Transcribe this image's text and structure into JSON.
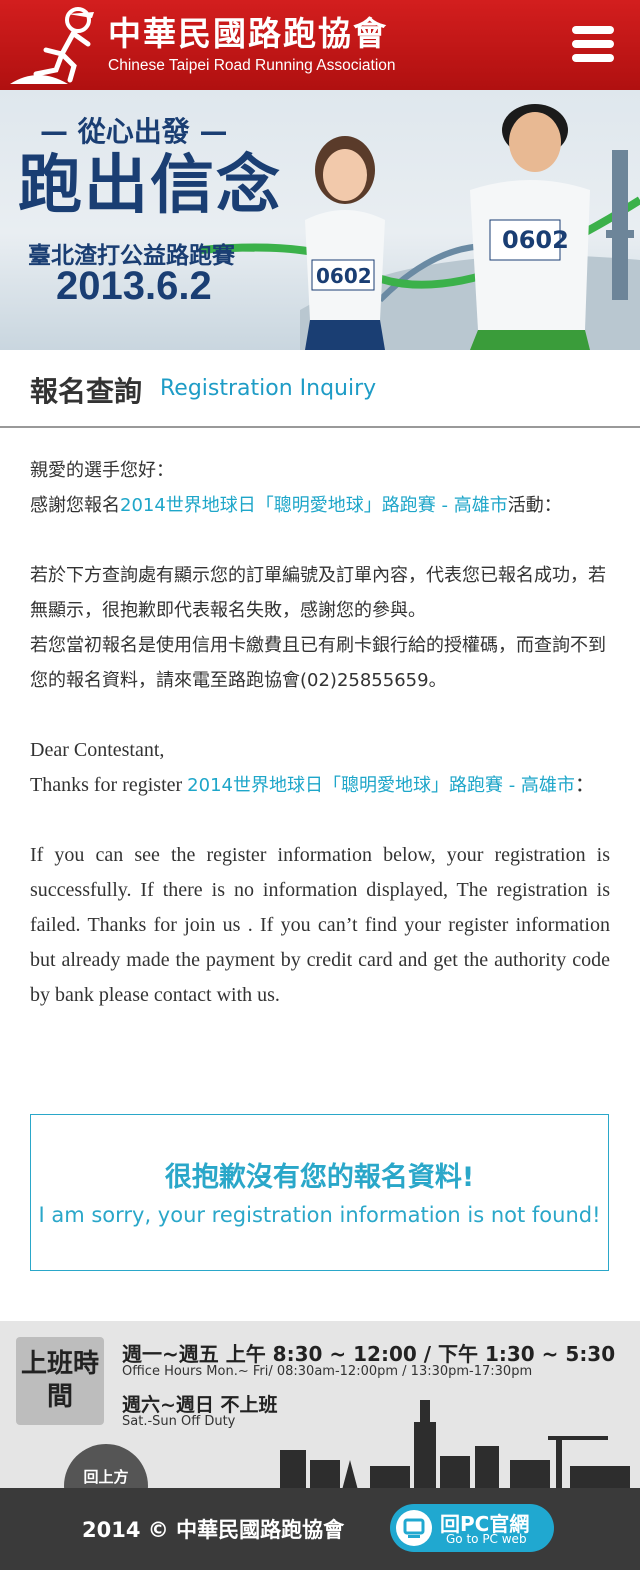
{
  "header": {
    "title": "中華民國路跑協會",
    "subtitle": "Chinese Taipei Road Running Association"
  },
  "banner": {
    "tagline": "— 從心出發 —",
    "headline": "跑出信念",
    "event": "臺北渣打公益路跑賽",
    "date": "2013.6.2",
    "bib_left": "0602",
    "bib_right": "0602"
  },
  "page": {
    "title_zh": "報名查詢",
    "title_en": "Registration Inquiry"
  },
  "content": {
    "greeting_zh": "親愛的選手您好：",
    "thanks_zh_pre": "感謝您報名",
    "event_name": "2014世界地球日「聰明愛地球」路跑賽 - 高雄市",
    "thanks_zh_post": "活動：",
    "para1_zh": "若於下方查詢處有顯示您的訂單編號及訂單內容，代表您已報名成功，若無顯示，很抱歉即代表報名失敗，感謝您的參與。",
    "para2_zh": "若您當初報名是使用信用卡繳費且已有刷卡銀行給的授權碼，而查詢不到您的報名資料，請來電至路跑協會(02)25855659。",
    "greeting_en": "Dear Contestant,",
    "thanks_en_pre": "Thanks for register ",
    "thanks_en_post": "：",
    "para_en": "If you can see the register information below, your registration is successfully. If there is no information displayed, The registration is failed. Thanks for join us . If you can’t find your register information but already made the payment by credit card and get the authority code by bank please contact with us."
  },
  "notice": {
    "zh": "很抱歉沒有您的報名資料!",
    "en": "I am sorry, your registration information is not found!"
  },
  "office": {
    "badge": "上班時間",
    "weekday_zh": "週一~週五 上午 8:30 ~ 12:00 / 下午 1:30 ~ 5:30",
    "weekday_en": "Office Hours  Mon.~ Fri/ 08:30am-12:00pm / 13:30pm-17:30pm",
    "weekend_zh": "週六~週日 不上班",
    "weekend_en": "Sat.-Sun Off Duty"
  },
  "footer": {
    "back_to_top": "回上方",
    "copyright": "2014 © 中華民國路跑協會",
    "pc_zh": "回PC官網",
    "pc_en": "Go to PC web"
  },
  "colors": {
    "header_red": "#c8161b",
    "accent_cyan": "#1ea6c9",
    "footer_dark": "#3a3a3a"
  },
  "icons": [
    "runner-logo-icon",
    "menu-icon",
    "monitor-icon"
  ]
}
